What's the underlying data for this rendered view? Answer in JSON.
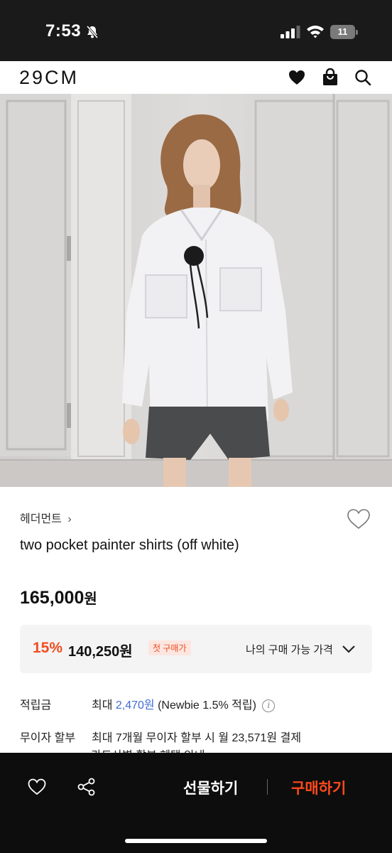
{
  "status_bar": {
    "time": "7:53",
    "battery": "11"
  },
  "header": {
    "logo": "29CM"
  },
  "product": {
    "brand": "헤더먼트",
    "brand_chevron": "›",
    "title": "two pocket painter shirts (off white)",
    "price_number": "165,000",
    "price_unit": "원",
    "discount": {
      "percent": "15%",
      "price": "140,250원",
      "badge": "첫 구매가",
      "my_price_label": "나의 구매 가능 가격"
    }
  },
  "info": {
    "points_label": "적립금",
    "points_prefix": "최대 ",
    "points_amount": "2,470원",
    "points_suffix": " (Newbie 1.5% 적립)",
    "installment_label": "무이자 할부",
    "installment_value": "최대 7개월 무이자 할부 시 월 23,571원 결제",
    "card_line": "카드사별 할부 혜택 안내"
  },
  "bottom_bar": {
    "gift_label": "선물하기",
    "buy_label": "구매하기"
  },
  "colors": {
    "accent": "#f04d22",
    "buy": "#ff4a1c",
    "link_blue": "#3f6cd6",
    "bar": "#0d0d0d"
  }
}
